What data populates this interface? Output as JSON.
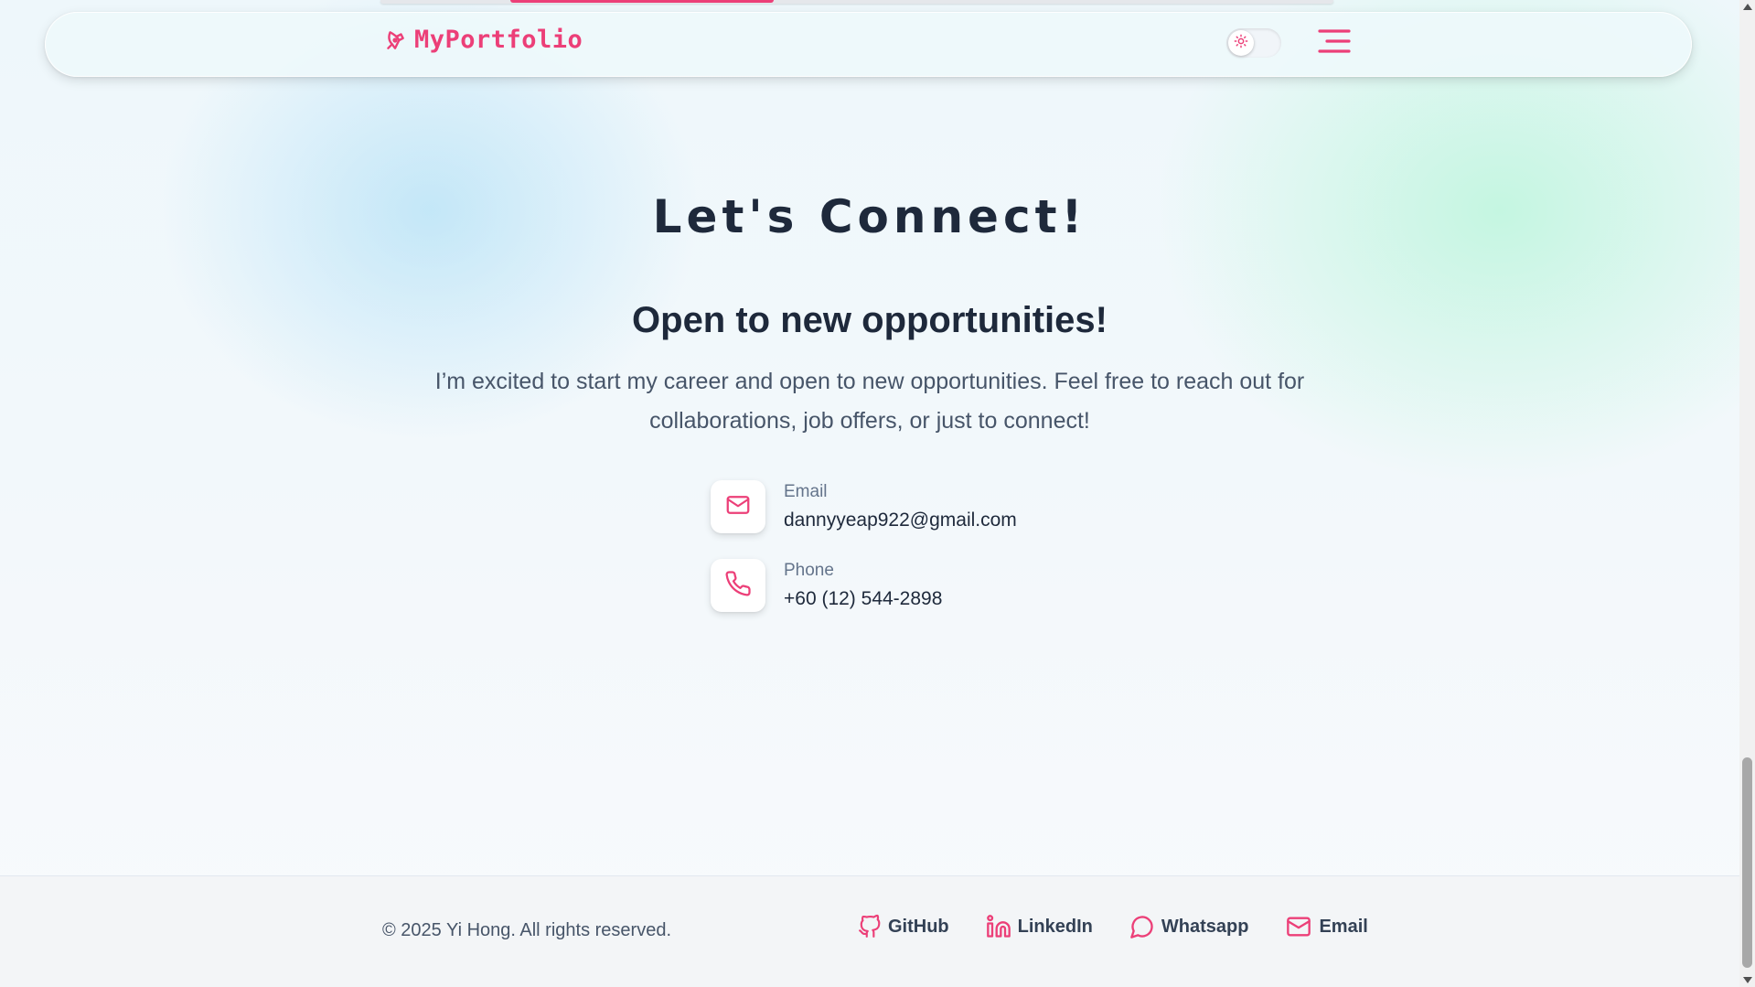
{
  "navbar": {
    "brand": "MyPortfolio",
    "brand_icon": "pen-nib-icon",
    "theme_toggle_icon": "sun-icon",
    "menu_icon": "hamburger-menu-icon"
  },
  "contact": {
    "title": "Let's Connect!",
    "subtitle": "Open to new opportunities!",
    "intro": "I’m excited to start my career and open to new opportunities. Feel free to reach out for collaborations, job offers, or just to connect!",
    "items": [
      {
        "label": "Email",
        "value": "dannyyeap922@gmail.com",
        "icon": "mail-icon"
      },
      {
        "label": "Phone",
        "value": "+60 (12) 544-2898",
        "icon": "phone-icon"
      }
    ]
  },
  "footer": {
    "copyright": "© 2025 Yi Hong. All rights reserved.",
    "links": [
      {
        "label": "GitHub",
        "icon": "github-icon"
      },
      {
        "label": "LinkedIn",
        "icon": "linkedin-icon"
      },
      {
        "label": "Whatsapp",
        "icon": "chat-bubble-icon"
      },
      {
        "label": "Email",
        "icon": "mail-icon"
      }
    ]
  },
  "colors": {
    "accent": "#ec3f78",
    "heading": "#1e293b",
    "body_text": "#475569"
  }
}
